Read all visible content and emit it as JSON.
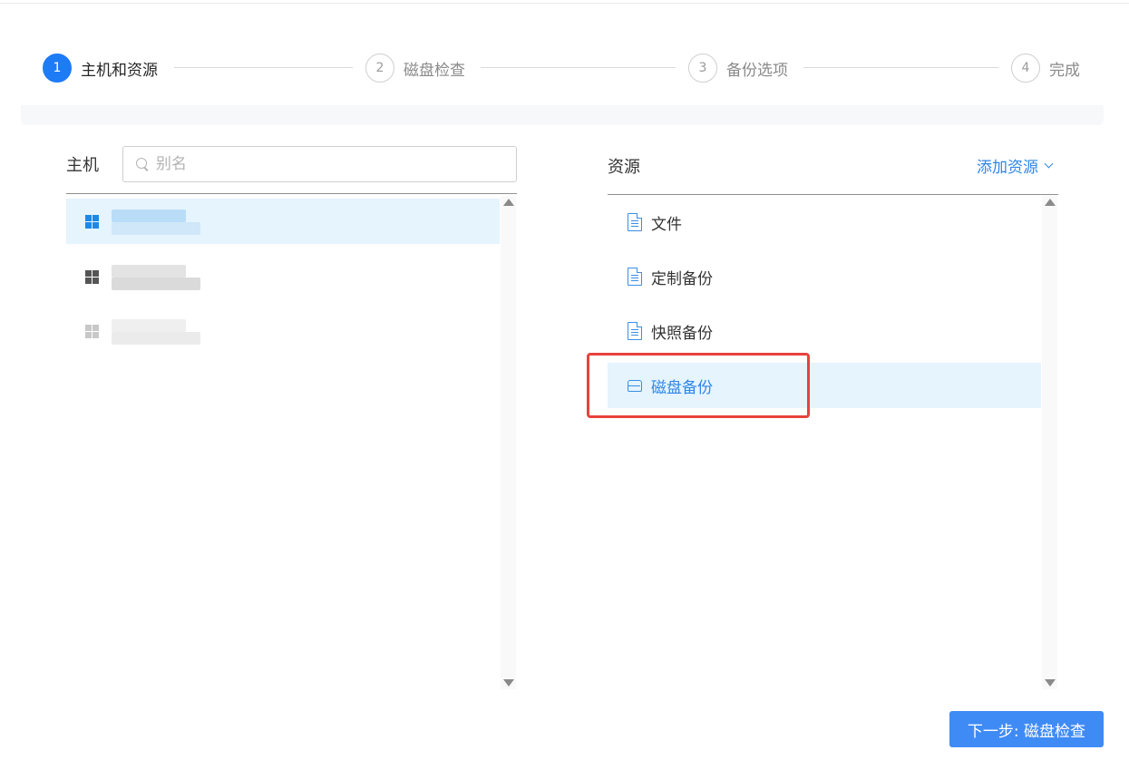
{
  "stepper": {
    "steps": [
      {
        "number": "1",
        "label": "主机和资源",
        "active": true
      },
      {
        "number": "2",
        "label": "磁盘检查",
        "active": false
      },
      {
        "number": "3",
        "label": "备份选项",
        "active": false
      },
      {
        "number": "4",
        "label": "完成",
        "active": false
      }
    ]
  },
  "hosts": {
    "title": "主机",
    "search_placeholder": "别名",
    "items": [
      {
        "os_icon": "windows-icon",
        "selected": true,
        "enabled": true
      },
      {
        "os_icon": "windows-icon",
        "selected": false,
        "enabled": true
      },
      {
        "os_icon": "windows-icon",
        "selected": false,
        "enabled": false
      }
    ]
  },
  "resources": {
    "title": "资源",
    "add_label": "添加资源",
    "items": [
      {
        "label": "文件",
        "icon": "file-icon",
        "selected": false
      },
      {
        "label": "定制备份",
        "icon": "file-icon",
        "selected": false
      },
      {
        "label": "快照备份",
        "icon": "file-icon",
        "selected": false
      },
      {
        "label": "磁盘备份",
        "icon": "disk-icon",
        "selected": true
      }
    ]
  },
  "actions": {
    "next_label": "下一步: 磁盘检查"
  },
  "colors": {
    "accent": "#1e7bf6",
    "link": "#2f86e8",
    "selected_row": "#e5f4fd",
    "highlight": "#e8423c",
    "button": "#3f8bf5"
  }
}
